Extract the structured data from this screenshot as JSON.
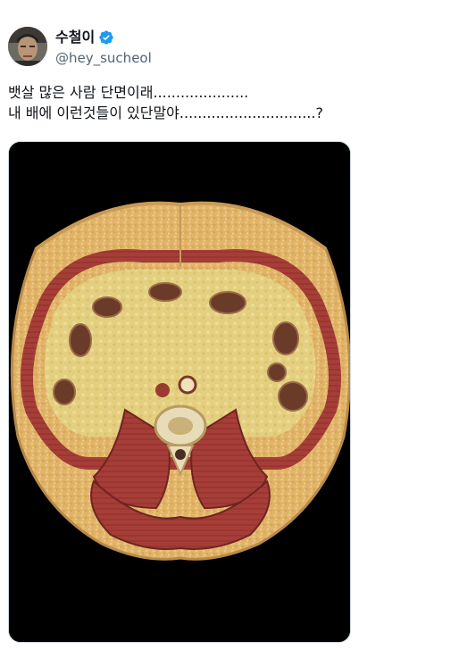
{
  "author": {
    "display_name": "수철이",
    "handle": "@hey_sucheol",
    "verified": true,
    "verified_color": "#1d9bf0"
  },
  "tweet": {
    "text_line1": "뱃살 많은 사람 단면이래.....................",
    "text_line2": "내 배에 이런것들이 있단말야..............................?"
  },
  "media": {
    "background": "#000000",
    "fat_color": "#e2b56a",
    "muscle_color": "#a8403a",
    "icon": "image"
  }
}
